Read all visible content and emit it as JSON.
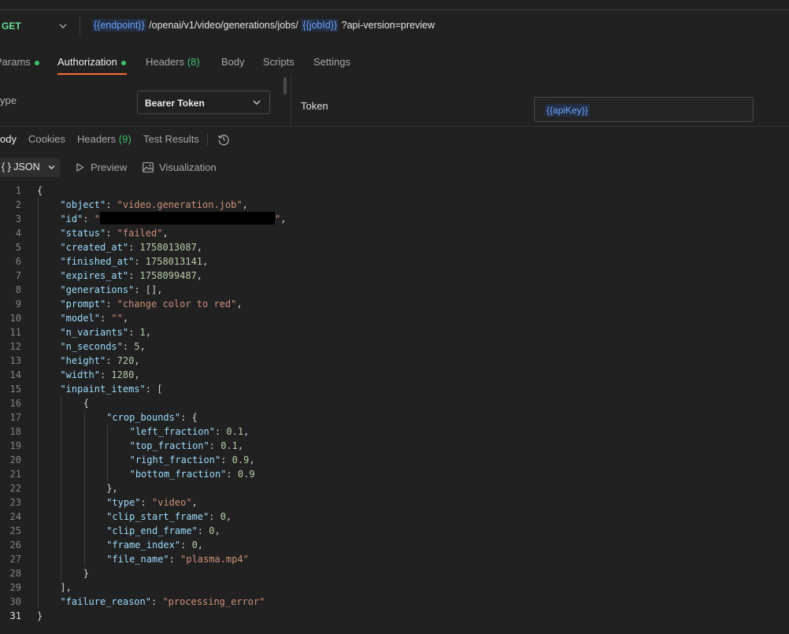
{
  "request": {
    "method": "GET",
    "url_parts": {
      "endpoint_var": "{{endpoint}}",
      "path": " /openai/v1/video/generations/jobs/ ",
      "jobid_var": "{{jobId}}",
      "query": " ?api-version=preview"
    },
    "tabs": {
      "params": "Params",
      "authorization": "Authorization",
      "headers": "Headers",
      "headers_count": "(8)",
      "body": "Body",
      "scripts": "Scripts",
      "settings": "Settings"
    }
  },
  "auth": {
    "type_label": "ype",
    "type_value": "Bearer Token",
    "token_label": "Token",
    "token_value": "{{apiKey}}"
  },
  "response": {
    "tabs": {
      "body": "ody",
      "cookies": "Cookies",
      "headers": "Headers",
      "headers_count": "(9)",
      "test_results": "Test Results"
    },
    "view": {
      "format": "{ } JSON",
      "preview": "Preview",
      "visualization": "Visualization"
    },
    "lines": [
      [
        {
          "t": "p",
          "v": "{"
        }
      ],
      [
        {
          "t": "k",
          "v": "\"object\""
        },
        {
          "t": "p",
          "v": ": "
        },
        {
          "t": "s",
          "v": "\"video.generation.job\""
        },
        {
          "t": "p",
          "v": ","
        }
      ],
      [
        {
          "t": "k",
          "v": "\"id\""
        },
        {
          "t": "p",
          "v": ": "
        },
        {
          "t": "s",
          "v": "\""
        },
        {
          "t": "r",
          "v": ""
        },
        {
          "t": "s",
          "v": "\""
        },
        {
          "t": "p",
          "v": ","
        }
      ],
      [
        {
          "t": "k",
          "v": "\"status\""
        },
        {
          "t": "p",
          "v": ": "
        },
        {
          "t": "s",
          "v": "\"failed\""
        },
        {
          "t": "p",
          "v": ","
        }
      ],
      [
        {
          "t": "k",
          "v": "\"created_at\""
        },
        {
          "t": "p",
          "v": ": "
        },
        {
          "t": "n",
          "v": "1758013087"
        },
        {
          "t": "p",
          "v": ","
        }
      ],
      [
        {
          "t": "k",
          "v": "\"finished_at\""
        },
        {
          "t": "p",
          "v": ": "
        },
        {
          "t": "n",
          "v": "1758013141"
        },
        {
          "t": "p",
          "v": ","
        }
      ],
      [
        {
          "t": "k",
          "v": "\"expires_at\""
        },
        {
          "t": "p",
          "v": ": "
        },
        {
          "t": "n",
          "v": "1758099487"
        },
        {
          "t": "p",
          "v": ","
        }
      ],
      [
        {
          "t": "k",
          "v": "\"generations\""
        },
        {
          "t": "p",
          "v": ": [],"
        }
      ],
      [
        {
          "t": "k",
          "v": "\"prompt\""
        },
        {
          "t": "p",
          "v": ": "
        },
        {
          "t": "s",
          "v": "\"change color to red\""
        },
        {
          "t": "p",
          "v": ","
        }
      ],
      [
        {
          "t": "k",
          "v": "\"model\""
        },
        {
          "t": "p",
          "v": ": "
        },
        {
          "t": "s",
          "v": "\"\""
        },
        {
          "t": "p",
          "v": ","
        }
      ],
      [
        {
          "t": "k",
          "v": "\"n_variants\""
        },
        {
          "t": "p",
          "v": ": "
        },
        {
          "t": "n",
          "v": "1"
        },
        {
          "t": "p",
          "v": ","
        }
      ],
      [
        {
          "t": "k",
          "v": "\"n_seconds\""
        },
        {
          "t": "p",
          "v": ": "
        },
        {
          "t": "n",
          "v": "5"
        },
        {
          "t": "p",
          "v": ","
        }
      ],
      [
        {
          "t": "k",
          "v": "\"height\""
        },
        {
          "t": "p",
          "v": ": "
        },
        {
          "t": "n",
          "v": "720"
        },
        {
          "t": "p",
          "v": ","
        }
      ],
      [
        {
          "t": "k",
          "v": "\"width\""
        },
        {
          "t": "p",
          "v": ": "
        },
        {
          "t": "n",
          "v": "1280"
        },
        {
          "t": "p",
          "v": ","
        }
      ],
      [
        {
          "t": "k",
          "v": "\"inpaint_items\""
        },
        {
          "t": "p",
          "v": ": ["
        }
      ],
      [
        {
          "t": "p",
          "v": "{"
        }
      ],
      [
        {
          "t": "k",
          "v": "\"crop_bounds\""
        },
        {
          "t": "p",
          "v": ": {"
        }
      ],
      [
        {
          "t": "k",
          "v": "\"left_fraction\""
        },
        {
          "t": "p",
          "v": ": "
        },
        {
          "t": "n",
          "v": "0.1"
        },
        {
          "t": "p",
          "v": ","
        }
      ],
      [
        {
          "t": "k",
          "v": "\"top_fraction\""
        },
        {
          "t": "p",
          "v": ": "
        },
        {
          "t": "n",
          "v": "0.1"
        },
        {
          "t": "p",
          "v": ","
        }
      ],
      [
        {
          "t": "k",
          "v": "\"right_fraction\""
        },
        {
          "t": "p",
          "v": ": "
        },
        {
          "t": "n",
          "v": "0.9"
        },
        {
          "t": "p",
          "v": ","
        }
      ],
      [
        {
          "t": "k",
          "v": "\"bottom_fraction\""
        },
        {
          "t": "p",
          "v": ": "
        },
        {
          "t": "n",
          "v": "0.9"
        }
      ],
      [
        {
          "t": "p",
          "v": "},"
        }
      ],
      [
        {
          "t": "k",
          "v": "\"type\""
        },
        {
          "t": "p",
          "v": ": "
        },
        {
          "t": "s",
          "v": "\"video\""
        },
        {
          "t": "p",
          "v": ","
        }
      ],
      [
        {
          "t": "k",
          "v": "\"clip_start_frame\""
        },
        {
          "t": "p",
          "v": ": "
        },
        {
          "t": "n",
          "v": "0"
        },
        {
          "t": "p",
          "v": ","
        }
      ],
      [
        {
          "t": "k",
          "v": "\"clip_end_frame\""
        },
        {
          "t": "p",
          "v": ": "
        },
        {
          "t": "n",
          "v": "0"
        },
        {
          "t": "p",
          "v": ","
        }
      ],
      [
        {
          "t": "k",
          "v": "\"frame_index\""
        },
        {
          "t": "p",
          "v": ": "
        },
        {
          "t": "n",
          "v": "0"
        },
        {
          "t": "p",
          "v": ","
        }
      ],
      [
        {
          "t": "k",
          "v": "\"file_name\""
        },
        {
          "t": "p",
          "v": ": "
        },
        {
          "t": "s",
          "v": "\"plasma.mp4\""
        }
      ],
      [
        {
          "t": "p",
          "v": "}"
        }
      ],
      [
        {
          "t": "p",
          "v": "],"
        }
      ],
      [
        {
          "t": "k",
          "v": "\"failure_reason\""
        },
        {
          "t": "p",
          "v": ": "
        },
        {
          "t": "s",
          "v": "\"processing_error\""
        }
      ],
      [
        {
          "t": "p",
          "v": "}"
        }
      ]
    ],
    "indents": [
      0,
      1,
      1,
      1,
      1,
      1,
      1,
      1,
      1,
      1,
      1,
      1,
      1,
      1,
      1,
      2,
      3,
      4,
      4,
      4,
      4,
      3,
      3,
      3,
      3,
      3,
      3,
      2,
      1,
      1,
      0
    ],
    "current_line": 31
  }
}
